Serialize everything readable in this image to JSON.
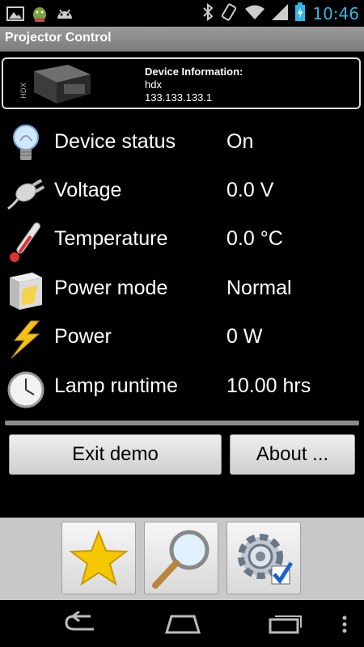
{
  "status_bar": {
    "time": "10:46"
  },
  "app": {
    "title": "Projector Control"
  },
  "device": {
    "heading": "Device Information:",
    "name": "hdx",
    "ip": "133.133.133.1",
    "image_label": "HDX"
  },
  "rows": [
    {
      "icon": "lightbulb-icon",
      "label": "Device status",
      "value": "On"
    },
    {
      "icon": "power-plug-icon",
      "label": "Voltage",
      "value": "0.0 V"
    },
    {
      "icon": "thermometer-icon",
      "label": "Temperature",
      "value": "0.0 °C"
    },
    {
      "icon": "power-mode-icon",
      "label": "Power mode",
      "value": "Normal"
    },
    {
      "icon": "lightning-bolt-icon",
      "label": "Power",
      "value": "0 W"
    },
    {
      "icon": "clock-icon",
      "label": "Lamp runtime",
      "value": "10.00 hrs"
    }
  ],
  "buttons": {
    "exit": "Exit demo",
    "about": "About ..."
  },
  "toolbar": [
    "star-icon",
    "magnifier-icon",
    "settings-gear-icon"
  ],
  "nav": [
    "back-icon",
    "home-icon",
    "recent-apps-icon",
    "overflow-menu-icon"
  ],
  "colors": {
    "clock": "#33b5e5",
    "titlebar": "#8a8a8a",
    "panel": "#c8c8c8"
  }
}
